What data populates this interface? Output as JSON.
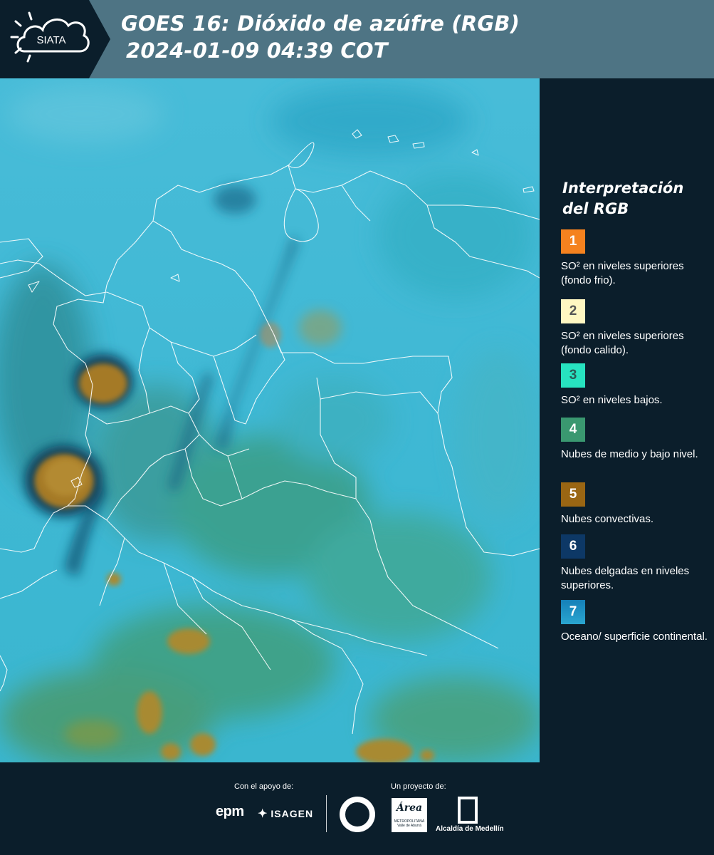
{
  "header": {
    "logo_text": "SIATA",
    "title_line1": "GOES 16: Dióxido de azúfre (RGB)",
    "title_line2": "2024-01-09 04:39 COT"
  },
  "legend": {
    "title": "Interpretación del RGB",
    "items": [
      {
        "number": "1",
        "color": "#f5821f",
        "text_color": "#ffffff",
        "label": "SO² en niveles superiores (fondo frio)."
      },
      {
        "number": "2",
        "color": "#fff7c2",
        "text_color": "#555555",
        "label": "SO² en niveles superiores (fondo calido)."
      },
      {
        "number": "3",
        "color": "#27e3c0",
        "text_color": "#2a5a55",
        "label": "SO² en niveles bajos."
      },
      {
        "number": "4",
        "color": "#3a9870",
        "text_color": "#ffffff",
        "label": "Nubes de medio y bajo nivel."
      },
      {
        "number": "5",
        "color": "#9a6613",
        "text_color": "#ffffff",
        "label": "Nubes convectivas."
      },
      {
        "number": "6",
        "color": "#0d3866",
        "text_color": "#ffffff",
        "label": "Nubes delgadas en niveles superiores."
      },
      {
        "number": "7",
        "color": "#1e95c4",
        "text_color": "#ffffff",
        "label": "Oceano/ superficie continental."
      }
    ]
  },
  "footer": {
    "support_label": "Con el apoyo de:",
    "project_label": "Un proyecto de:",
    "sponsor_1": "epm",
    "sponsor_2": "ISAGEN",
    "partner_area": "Área",
    "partner_area_sub": "METROPOLITANA Valle de Aburrá",
    "partner_alcaldia": "Alcaldía de Medellín"
  }
}
